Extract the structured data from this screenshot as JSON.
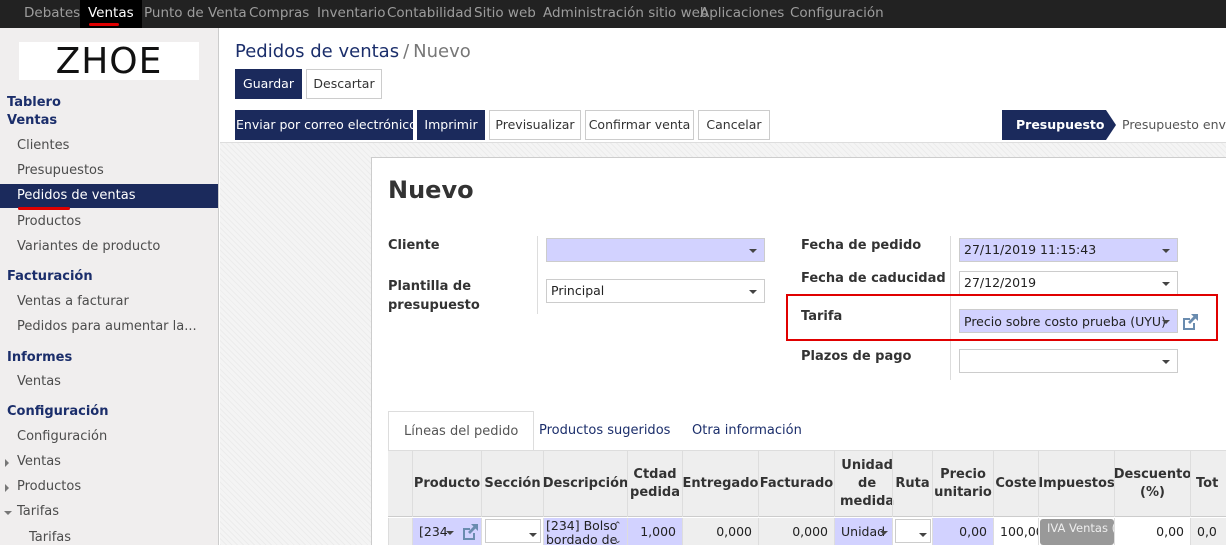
{
  "topnav": {
    "items": [
      "Debates",
      "Ventas",
      "Punto de Venta",
      "Compras",
      "Inventario",
      "Contabilidad",
      "Sitio web",
      "Administración sitio web",
      "Aplicaciones",
      "Configuración"
    ],
    "active": "Ventas"
  },
  "logo": "ZHOE",
  "sidebar": {
    "h_tablero": "Tablero",
    "h_ventas": "Ventas",
    "ventas_items": [
      "Clientes",
      "Presupuestos",
      "Pedidos de ventas",
      "Productos",
      "Variantes de producto"
    ],
    "h_facturacion": "Facturación",
    "facturacion_items": [
      "Ventas a facturar",
      "Pedidos para aumentar la..."
    ],
    "h_informes": "Informes",
    "informes_items": [
      "Ventas"
    ],
    "h_configuracion": "Configuración",
    "config_items": [
      "Configuración",
      "Ventas",
      "Productos",
      "Tarifas"
    ],
    "sub_tarifas": "Tarifas"
  },
  "breadcrumb": {
    "parent": "Pedidos de ventas",
    "sep": "/",
    "current": "Nuevo"
  },
  "buttons": {
    "save": "Guardar",
    "discard": "Descartar"
  },
  "actions": [
    "Enviar por correo electrónico",
    "Imprimir",
    "Previsualizar",
    "Confirmar venta",
    "Cancelar"
  ],
  "status": {
    "active": "Presupuesto",
    "next": "Presupuesto envia"
  },
  "form": {
    "title": "Nuevo",
    "cliente_label": "Cliente",
    "cliente_value": "",
    "plantilla_label_1": "Plantilla de",
    "plantilla_label_2": "presupuesto",
    "plantilla_value": "Principal",
    "fecha_pedido_label": "Fecha de pedido",
    "fecha_pedido_value": "27/11/2019 11:15:43",
    "fecha_caducidad_label": "Fecha de caducidad",
    "fecha_caducidad_value": "27/12/2019",
    "tarifa_label": "Tarifa",
    "tarifa_value": "Precio sobre costo prueba (UYU)",
    "plazos_label": "Plazos de pago",
    "plazos_value": ""
  },
  "tabs": [
    "Líneas del pedido",
    "Productos sugeridos",
    "Otra información"
  ],
  "table": {
    "headers": {
      "producto": "Producto",
      "seccion": "Sección",
      "descripcion": "Descripción",
      "ctdad_1": "Ctdad",
      "ctdad_2": "pedida",
      "entregado": "Entregado",
      "facturado": "Facturado",
      "unidad_1": "Unidad",
      "unidad_2": "de",
      "unidad_3": "medida",
      "ruta": "Ruta",
      "precio_1": "Precio",
      "precio_2": "unitario",
      "coste": "Coste",
      "impuestos": "Impuestos",
      "descuento_1": "Descuento",
      "descuento_2": "(%)",
      "total": "Tot"
    },
    "row": {
      "producto": "[234",
      "descripcion_1": "[234] Bolso",
      "descripcion_2": "bordado de",
      "ctdad": "1,000",
      "entregado": "0,000",
      "facturado": "0,000",
      "unidad": "Unidad",
      "precio": "0,00",
      "coste": "100,00",
      "impuestos": "IVA Ventas (",
      "descuento": "0,00",
      "total": "0,0"
    }
  },
  "colors": {
    "navy": "#1b2a5c",
    "highlight_red": "#e00000",
    "required_bg": "#d2d2ff"
  }
}
